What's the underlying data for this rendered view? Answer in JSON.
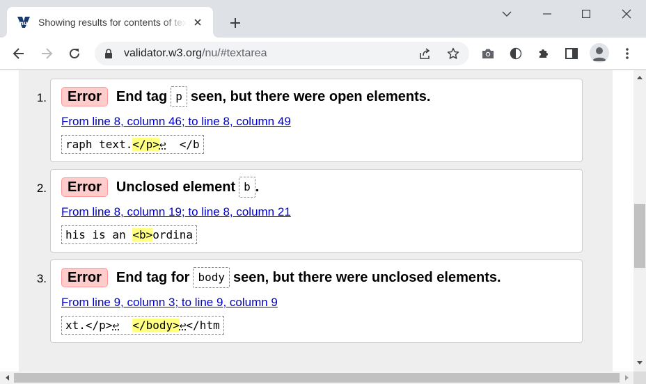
{
  "tab": {
    "title": "Showing results for contents of text-input area - Nu Html Checker",
    "favicon": "nu-logo-icon"
  },
  "toolbar": {
    "url_host": "validator.w3.org",
    "url_path": "/nu/#textarea"
  },
  "colors": {
    "error_badge_bg": "#ffcccc",
    "error_badge_border": "#ff9999",
    "link": "#0000cc",
    "highlight": "#ffff80",
    "page_bg": "#eeeeee"
  },
  "results": [
    {
      "number": "1.",
      "type": "Error",
      "msg_before": "End tag",
      "code": "p",
      "msg_after": "seen, but there were open elements.",
      "location": "From line 8, column 46; to line 8, column 49",
      "extract_pre": "raph text.",
      "extract_hl": "</p>",
      "extract_lf": "↩",
      "extract_post": "  </b"
    },
    {
      "number": "2.",
      "type": "Error",
      "msg_before": "Unclosed element",
      "code": "b",
      "msg_after": ".",
      "location": "From line 8, column 19; to line 8, column 21",
      "extract_pre": "his is an ",
      "extract_hl": "<b>",
      "extract_lf": "",
      "extract_post": "ordina"
    },
    {
      "number": "3.",
      "type": "Error",
      "msg_before": "End tag for",
      "code": "body",
      "msg_after": "seen, but there were unclosed elements.",
      "location": "From line 9, column 3; to line 9, column 9",
      "extract_pre": "xt.</p>",
      "extract_lf0": "↩",
      "extract_mid": "  ",
      "extract_hl": "</body>",
      "extract_lf": "↩",
      "extract_post": "</htm"
    }
  ]
}
